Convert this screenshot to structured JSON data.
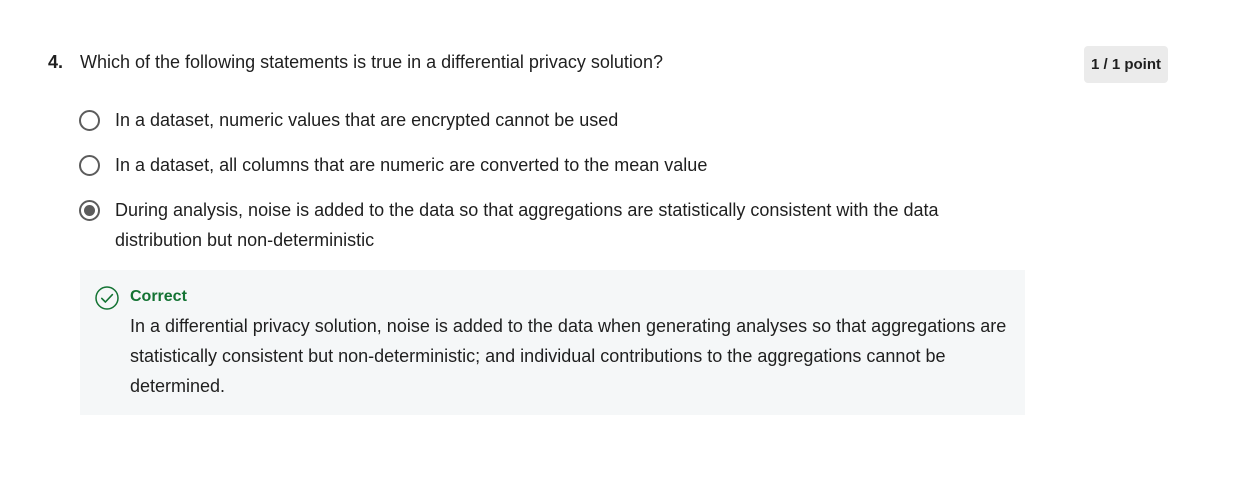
{
  "question": {
    "number": "4.",
    "text": "Which of the following statements is true in a differential privacy solution?",
    "points": "1 / 1 point"
  },
  "options": [
    {
      "label": "In a dataset, numeric values that are encrypted cannot be used",
      "selected": false
    },
    {
      "label": "In a dataset, all columns that are numeric are converted to the mean value",
      "selected": false
    },
    {
      "label": "During analysis, noise is added to the data so that aggregations are statistically consistent with the data distribution but non-deterministic",
      "selected": true
    }
  ],
  "feedback": {
    "status": "Correct",
    "icon": "check-circle-icon",
    "color": "#137333",
    "explanation": "In a differential privacy solution, noise is added to the data when generating analyses so that aggregations are statistically consistent but non-deterministic; and individual contributions to the aggregations cannot be determined."
  }
}
